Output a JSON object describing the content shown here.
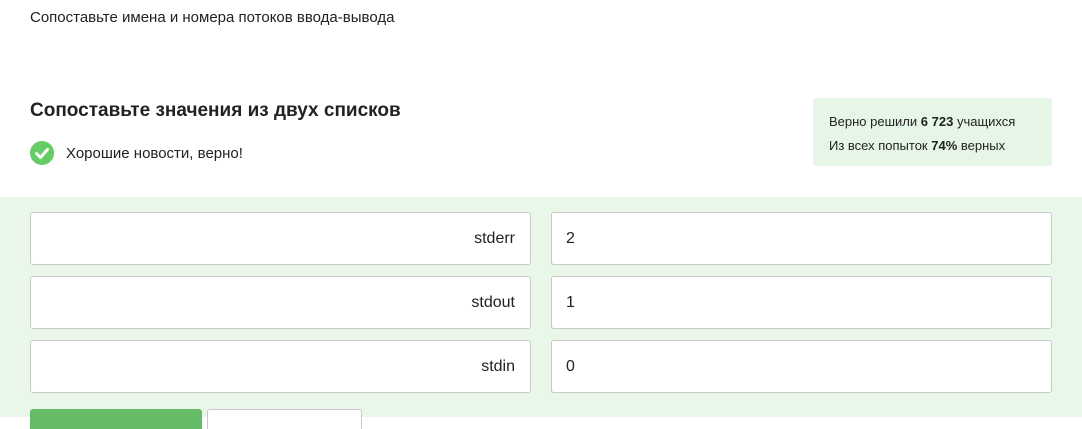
{
  "task": {
    "text": "Сопоставьте имена и номера потоков ввода-вывода"
  },
  "quiz": {
    "title": "Сопоставьте значения из двух списков",
    "result_icon": "check-circle-icon",
    "result_text": "Хорошие новости, верно!",
    "accent_color": "#66cc66"
  },
  "stats": {
    "solved_prefix": "Верно решили",
    "solved_count": "6 723",
    "solved_suffix": "учащихся",
    "attempts_prefix": "Из всех попыток",
    "attempts_percent": "74%",
    "attempts_suffix": "верных"
  },
  "matching": {
    "rows": [
      {
        "left": "stderr",
        "right": "2"
      },
      {
        "left": "stdout",
        "right": "1"
      },
      {
        "left": "stdin",
        "right": "0"
      }
    ]
  }
}
